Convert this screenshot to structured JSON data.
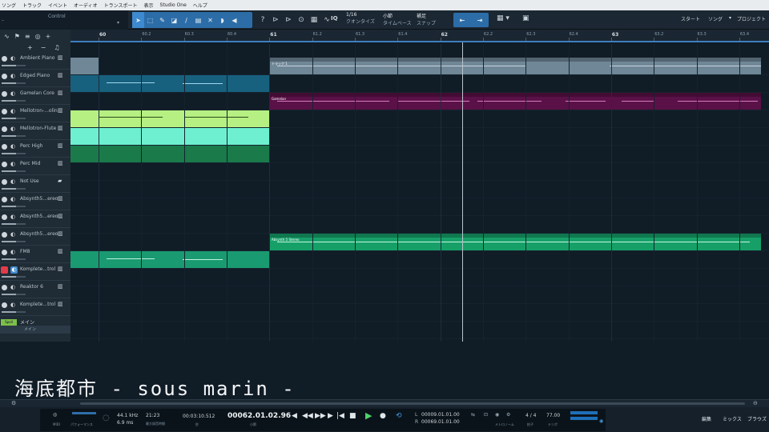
{
  "menu": [
    "ソング",
    "トラック",
    "イベント",
    "オーディオ",
    "トランスポート",
    "表示",
    "Studio One",
    "ヘルプ"
  ],
  "toolbar": {
    "control_label": "Control",
    "iq_label": "IQ",
    "quantize_value": "1/16",
    "quantize_label": "クオンタイズ",
    "timebase_value": "小節",
    "timebase_label": "タイムベース",
    "snap_value": "補足",
    "snap_label": "スナップ",
    "start_label": "スタート",
    "song_label": "ソング",
    "project_label": "プロジェクト"
  },
  "tracks": [
    {
      "name": "Ambient Piano",
      "icon": "keyboard-icon"
    },
    {
      "name": "Edged Piano",
      "icon": "keyboard-icon"
    },
    {
      "name": "Gamelan Core",
      "icon": "keyboard-icon"
    },
    {
      "name": "Mellotron-...olin",
      "icon": "keyboard-icon"
    },
    {
      "name": "Mellotron-Flute",
      "icon": "keyboard-icon"
    },
    {
      "name": "Perc High",
      "icon": "keyboard-icon"
    },
    {
      "name": "Perc Mid",
      "icon": "keyboard-icon"
    },
    {
      "name": "Not Use",
      "icon": "folder-icon"
    },
    {
      "name": "Absynth5...ereo",
      "icon": "keyboard-icon"
    },
    {
      "name": "Absynth5...ereo",
      "icon": "keyboard-icon"
    },
    {
      "name": "Absynth5...ereo",
      "icon": "keyboard-icon"
    },
    {
      "name": "FM8",
      "icon": "keyboard-icon"
    },
    {
      "name": "Komplete...trol",
      "icon": "keyboard-icon"
    },
    {
      "name": "Reaktor 6",
      "icon": "keyboard-icon"
    },
    {
      "name": "Komplete...trol",
      "icon": "keyboard-icon"
    }
  ],
  "main_track": {
    "name": "メイン",
    "sub": "メイン",
    "tag": "Spell"
  },
  "ruler": {
    "major": [
      "60",
      "61",
      "62",
      "63"
    ],
    "minor": [
      "60.2",
      "60.3",
      "60.4",
      "61.2",
      "61.3",
      "61.4",
      "62.2",
      "62.3",
      "62.4",
      "63.2",
      "63.3",
      "63.4"
    ]
  },
  "clips": {
    "track1": "トラック 1",
    "gamelan": "Gamelan",
    "absynth": "Absynth 5 Stereo"
  },
  "caption": "海底都市 - sous marin -",
  "colors": {
    "piano_gray": "#6f8797",
    "edged_blue": "#17607e",
    "gamelan_purple": "#5a1147",
    "mellotron_lime": "#b6f082",
    "mellotron_cyan": "#6ef0d0",
    "perc_green": "#1a7a4a",
    "absynth_green": "#16a068",
    "fm8_teal": "#1a9a70"
  },
  "transport": {
    "midi_label": "MIDI",
    "perf_label": "パフォーマンス",
    "sample_rate": "44.1 kHz",
    "latency": "6.9 ms",
    "clock": "21:23",
    "clock_label": "最大録音時間",
    "time": "00:03:10.512",
    "time_label": "秒",
    "position": "00062.01.02.96",
    "position_label": "小節",
    "loop_start": "00009.01.01.00",
    "loop_end": "00069.01.01.00",
    "metronome_label": "メトロノーム",
    "timesig": "4 / 4",
    "timesig_label": "拍子",
    "tempo": "77.00",
    "tempo_label": "テンポ",
    "tab_edit": "編集",
    "tab_mix": "ミックス",
    "tab_browse": "ブラウズ"
  }
}
